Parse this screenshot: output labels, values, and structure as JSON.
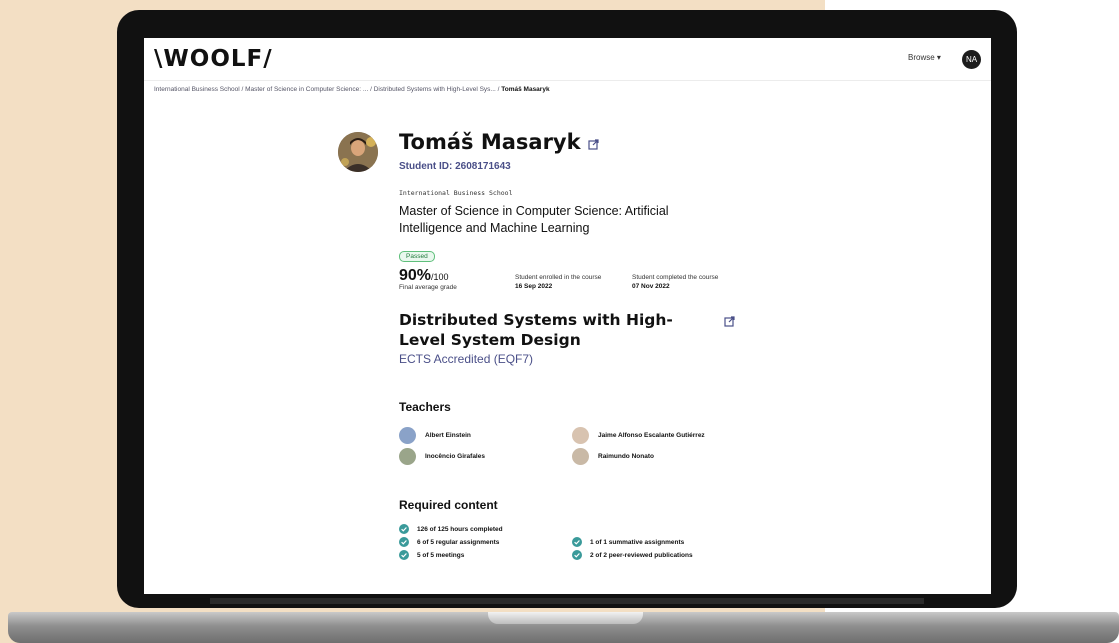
{
  "header": {
    "logo": "\\WOOLF/",
    "browse_label": "Browse",
    "user_initials": "NA"
  },
  "breadcrumb": [
    "International Business School",
    "Master of Science in Computer Science: ...",
    "Distributed Systems with High-Level Sys...",
    "Tomáš Masaryk"
  ],
  "student": {
    "name": "Tomáš Masaryk",
    "student_id": "Student ID: 2608171643",
    "school": "International Business School",
    "program": "Master of Science in Computer Science: Artificial Intelligence and Machine Learning"
  },
  "result": {
    "status": "Passed",
    "grade": "90%",
    "grade_max": "/100",
    "grade_label": "Final average grade",
    "enrolled_label": "Student enrolled in the course",
    "enrolled_date": "16 Sep 2022",
    "completed_label": "Student completed the course",
    "completed_date": "07 Nov 2022"
  },
  "course": {
    "title": "Distributed Systems with High-Level System Design",
    "accreditation": "ECTS Accredited (EQF7)"
  },
  "teachers": {
    "heading": "Teachers",
    "list": [
      "Albert Einstein",
      "Jaime Alfonso Escalante Gutiérrez",
      "Inocêncio Girafales",
      "Raimundo Nonato"
    ]
  },
  "required": {
    "heading": "Required content",
    "items": [
      "126 of 125 hours completed",
      "6 of 5 regular assignments",
      "1 of 1 summative assignments",
      "5 of 5 meetings",
      "2 of 2 peer-reviewed publications"
    ]
  },
  "colors": {
    "accent": "#4a4f88",
    "passed_green": "#217a3c",
    "check_teal": "#3a9a9a",
    "background_tan": "#f3dfc4"
  }
}
